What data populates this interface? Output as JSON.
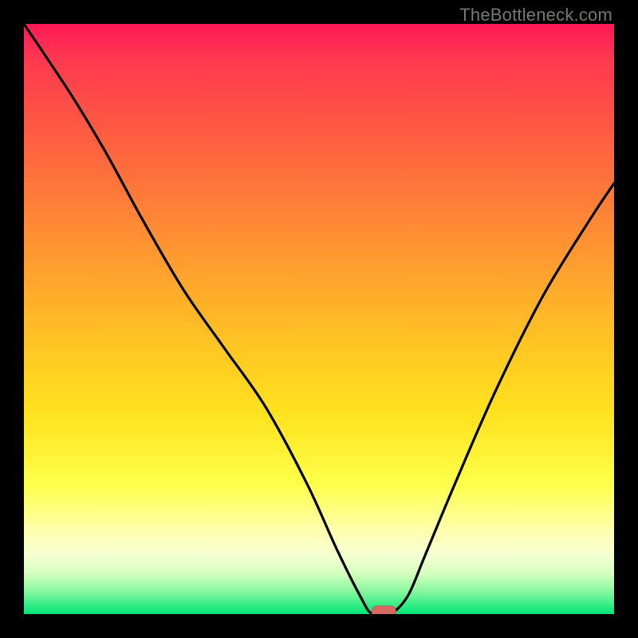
{
  "watermark": {
    "text": "TheBottleneck.com"
  },
  "colors": {
    "frame": "#000000",
    "curve_stroke": "#000000",
    "marker_fill": "#d96a62",
    "marker_stroke": "#b85a55"
  },
  "chart_data": {
    "type": "line",
    "title": "",
    "xlabel": "",
    "ylabel": "",
    "xlim": [
      0,
      100
    ],
    "ylim": [
      0,
      100
    ],
    "grid": false,
    "legend": false,
    "background_gradient_stops": [
      {
        "pos": 0,
        "color": "#ff1a57"
      },
      {
        "pos": 18,
        "color": "#ff5a42"
      },
      {
        "pos": 42,
        "color": "#ffa12e"
      },
      {
        "pos": 66,
        "color": "#ffe21e"
      },
      {
        "pos": 86,
        "color": "#ffffb0"
      },
      {
        "pos": 96,
        "color": "#8cf7a0"
      },
      {
        "pos": 100,
        "color": "#00e676"
      }
    ],
    "series": [
      {
        "name": "bottleneck-curve",
        "x": [
          0,
          8,
          14,
          20,
          27,
          34,
          41,
          48,
          53,
          57,
          59,
          62,
          65,
          68,
          73,
          80,
          88,
          96,
          100
        ],
        "values": [
          100,
          88,
          78,
          67,
          55,
          45,
          35,
          22,
          11,
          3,
          0,
          0,
          3,
          10,
          22,
          38,
          54,
          67,
          73
        ]
      }
    ],
    "marker": {
      "xmin": 59,
      "xmax": 63,
      "y": 0
    }
  }
}
